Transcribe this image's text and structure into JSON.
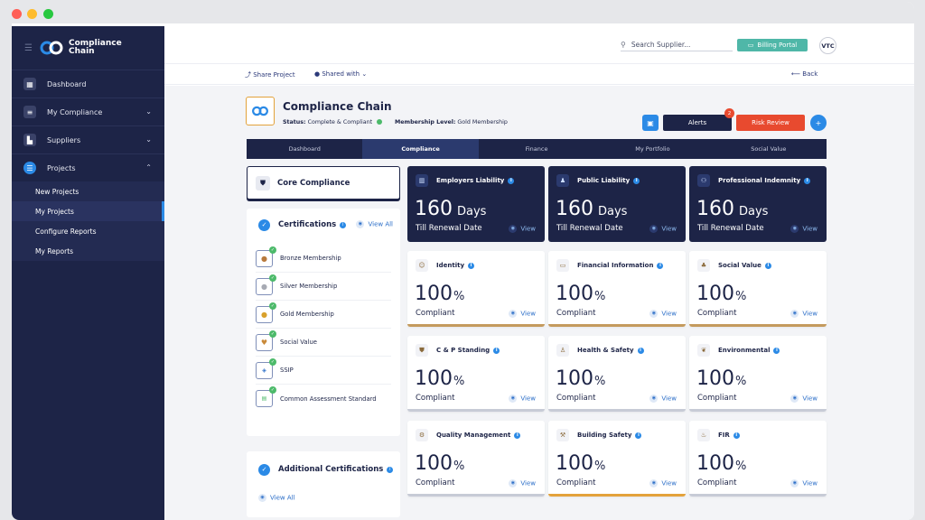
{
  "sidebar": {
    "brand": [
      "Compliance",
      "Chain"
    ],
    "nav": [
      {
        "label": "Dashboard",
        "icon": "dashboard-icon",
        "chevron": ""
      },
      {
        "label": "My Compliance",
        "icon": "list-icon",
        "chevron": "⌄"
      },
      {
        "label": "Suppliers",
        "icon": "factory-icon",
        "chevron": "⌄"
      },
      {
        "label": "Projects",
        "icon": "projects-icon",
        "chevron": "⌃"
      }
    ],
    "subnav": [
      "New Projects",
      "My Projects",
      "Configure Reports",
      "My Reports"
    ]
  },
  "header": {
    "search_placeholder": "Search Supplier...",
    "billing": "Billing Portal",
    "avatar": "VTC",
    "share": "Share Project",
    "shared_with": "Shared with",
    "back": "Back"
  },
  "company": {
    "name": "Compliance Chain",
    "status_label": "Status:",
    "status": "Complete & Compliant",
    "membership_label": "Membership Level:",
    "membership": "Gold Membership",
    "alerts": "Alerts",
    "alerts_count": "2",
    "risk": "Risk Review"
  },
  "tabs": [
    "Dashboard",
    "Compliance",
    "Finance",
    "My Portfolio",
    "Social Value"
  ],
  "left": {
    "core": "Core Compliance",
    "certifications": "Certifications",
    "view_all": "View All",
    "certs": [
      "Bronze Membership",
      "Silver Membership",
      "Gold Membership",
      "Social Value",
      "SSIP",
      "Common Assessment Standard"
    ],
    "additional": "Additional Certifications",
    "additional_view_all": "View All"
  },
  "cards": [
    {
      "title": "Employers Liability",
      "big": "160",
      "unit": "Days",
      "label": "Till Renewal Date",
      "view": "View",
      "style": "dark",
      "icon": "building-icon"
    },
    {
      "title": "Public Liability",
      "big": "160",
      "unit": "Days",
      "label": "Till Renewal Date",
      "view": "View",
      "style": "dark",
      "icon": "people-icon"
    },
    {
      "title": "Professional Indemnity",
      "big": "160",
      "unit": "Days",
      "label": "Till Renewal Date",
      "view": "View",
      "style": "dark",
      "icon": "group-icon"
    },
    {
      "title": "Identity",
      "big": "100",
      "unit": "%",
      "label": "Compliant",
      "view": "View",
      "style": "light",
      "icon": "face-icon",
      "bar": "#c49a5d"
    },
    {
      "title": "Financial Information",
      "big": "100",
      "unit": "%",
      "label": "Compliant",
      "view": "View",
      "style": "light",
      "icon": "money-icon",
      "bar": "#c49a5d"
    },
    {
      "title": "Social Value",
      "big": "100",
      "unit": "%",
      "label": "Compliant",
      "view": "View",
      "style": "light",
      "icon": "sprout-icon",
      "bar": "#c49a5d"
    },
    {
      "title": "C & P Standing",
      "big": "100",
      "unit": "%",
      "label": "Compliant",
      "view": "View",
      "style": "light",
      "icon": "shield-icon",
      "bar": "#c7cbd6"
    },
    {
      "title": "Health & Safety",
      "big": "100",
      "unit": "%",
      "label": "Compliant",
      "view": "View",
      "style": "light",
      "icon": "worker-icon",
      "bar": "#c7cbd6"
    },
    {
      "title": "Environmental",
      "big": "100",
      "unit": "%",
      "label": "Compliant",
      "view": "View",
      "style": "light",
      "icon": "leaf-icon",
      "bar": "#c7cbd6"
    },
    {
      "title": "Quality Management",
      "big": "100",
      "unit": "%",
      "label": "Compliant",
      "view": "View",
      "style": "light",
      "icon": "gear-icon",
      "bar": "#c7cbd6"
    },
    {
      "title": "Building Safety",
      "big": "100",
      "unit": "%",
      "label": "Compliant",
      "view": "View",
      "style": "light",
      "icon": "crane-icon",
      "bar": "#e3a23b"
    },
    {
      "title": "FIR",
      "big": "100",
      "unit": "%",
      "label": "Compliant",
      "view": "View",
      "style": "light",
      "icon": "fire-icon",
      "bar": "#c7cbd6"
    }
  ]
}
